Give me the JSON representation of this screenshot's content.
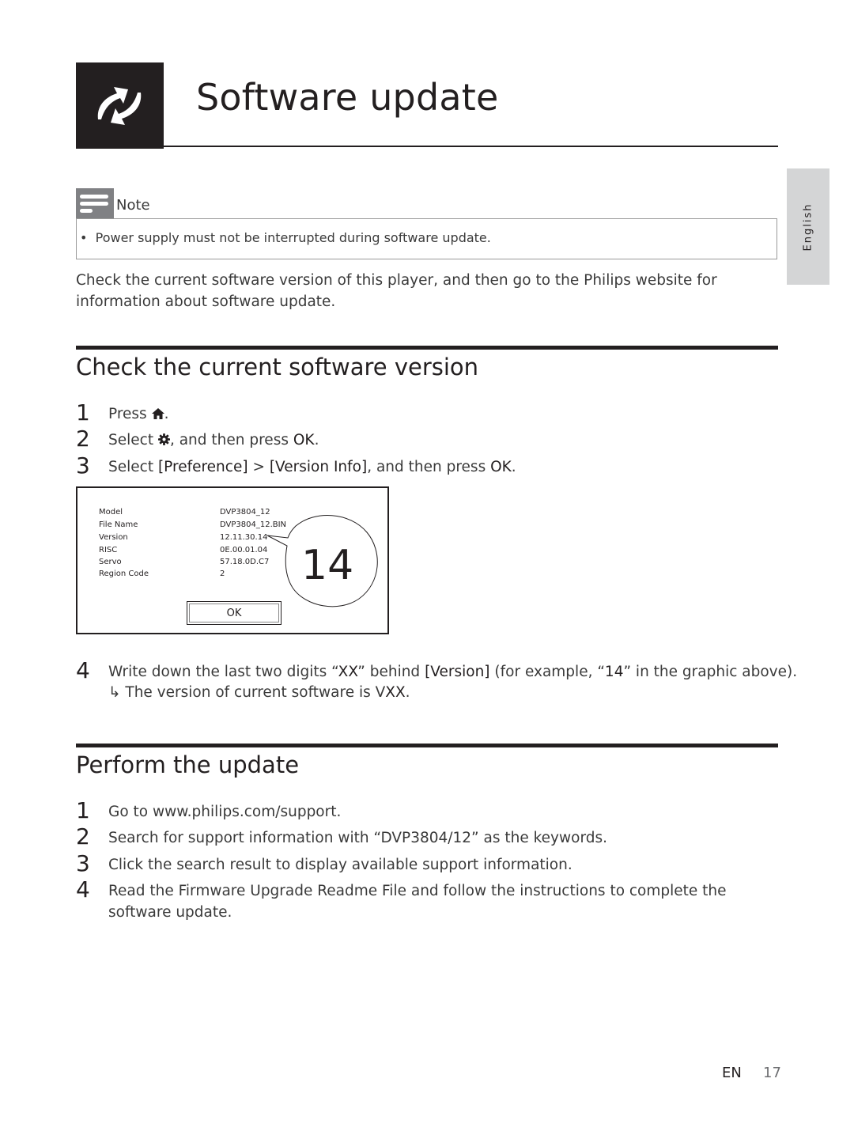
{
  "chapter": {
    "icon": "refresh-arrows-icon",
    "title": "Software update"
  },
  "language_tab": "English",
  "note": {
    "icon": "note-lines-icon",
    "label": "Note",
    "items": [
      "Power supply must not be interrupted during software update."
    ]
  },
  "intro": "Check the current software version of this player, and then go to the Philips website for information about software update.",
  "check_section": {
    "title": "Check the current software version",
    "steps": [
      {
        "num": "1",
        "pre": "Press ",
        "icon": "home-icon",
        "post": "."
      },
      {
        "num": "2",
        "pre": "Select ",
        "icon": "gear-icon",
        "mid": ", and then press ",
        "bold": "OK",
        "post": "."
      },
      {
        "num": "3",
        "pre": "Select ",
        "bold1": "[Preference]",
        "sep": " > ",
        "bold2": "[Version Info]",
        "mid": ", and then press ",
        "bold3": "OK",
        "post": "."
      }
    ],
    "screen": {
      "rows": [
        {
          "label": "Model",
          "value": "DVP3804_12"
        },
        {
          "label": "File Name",
          "value": "DVP3804_12.BIN"
        },
        {
          "label": "Version",
          "value": "12.11.30.14"
        },
        {
          "label": "RISC",
          "value": "0E.00.01.04"
        },
        {
          "label": "Servo",
          "value": "57.18.0D.C7"
        },
        {
          "label": "Region Code",
          "value": "2"
        }
      ],
      "ok_label": "OK",
      "callout": "14"
    },
    "step4": {
      "num": "4",
      "t1": "Write down the last two digits “",
      "b1": "XX",
      "t2": "” behind ",
      "b2": "[Version]",
      "t3": " (for example, “",
      "b3": "14",
      "t4": "” in the graphic above)."
    },
    "result": {
      "arrow": "↳",
      "text": " The version of current software is V",
      "bold": "XX",
      "post": "."
    }
  },
  "update_section": {
    "title": "Perform the update",
    "steps": [
      {
        "num": "1",
        "text": "Go to www.philips.com/support."
      },
      {
        "num": "2",
        "text": "Search for support information with “DVP3804/12” as the keywords."
      },
      {
        "num": "3",
        "text": "Click the search result to display available support information."
      },
      {
        "num": "4",
        "text": "Read the Firmware Upgrade Readme File and follow the instructions to complete the software update."
      }
    ]
  },
  "footer": {
    "lang": "EN",
    "page": "17"
  }
}
